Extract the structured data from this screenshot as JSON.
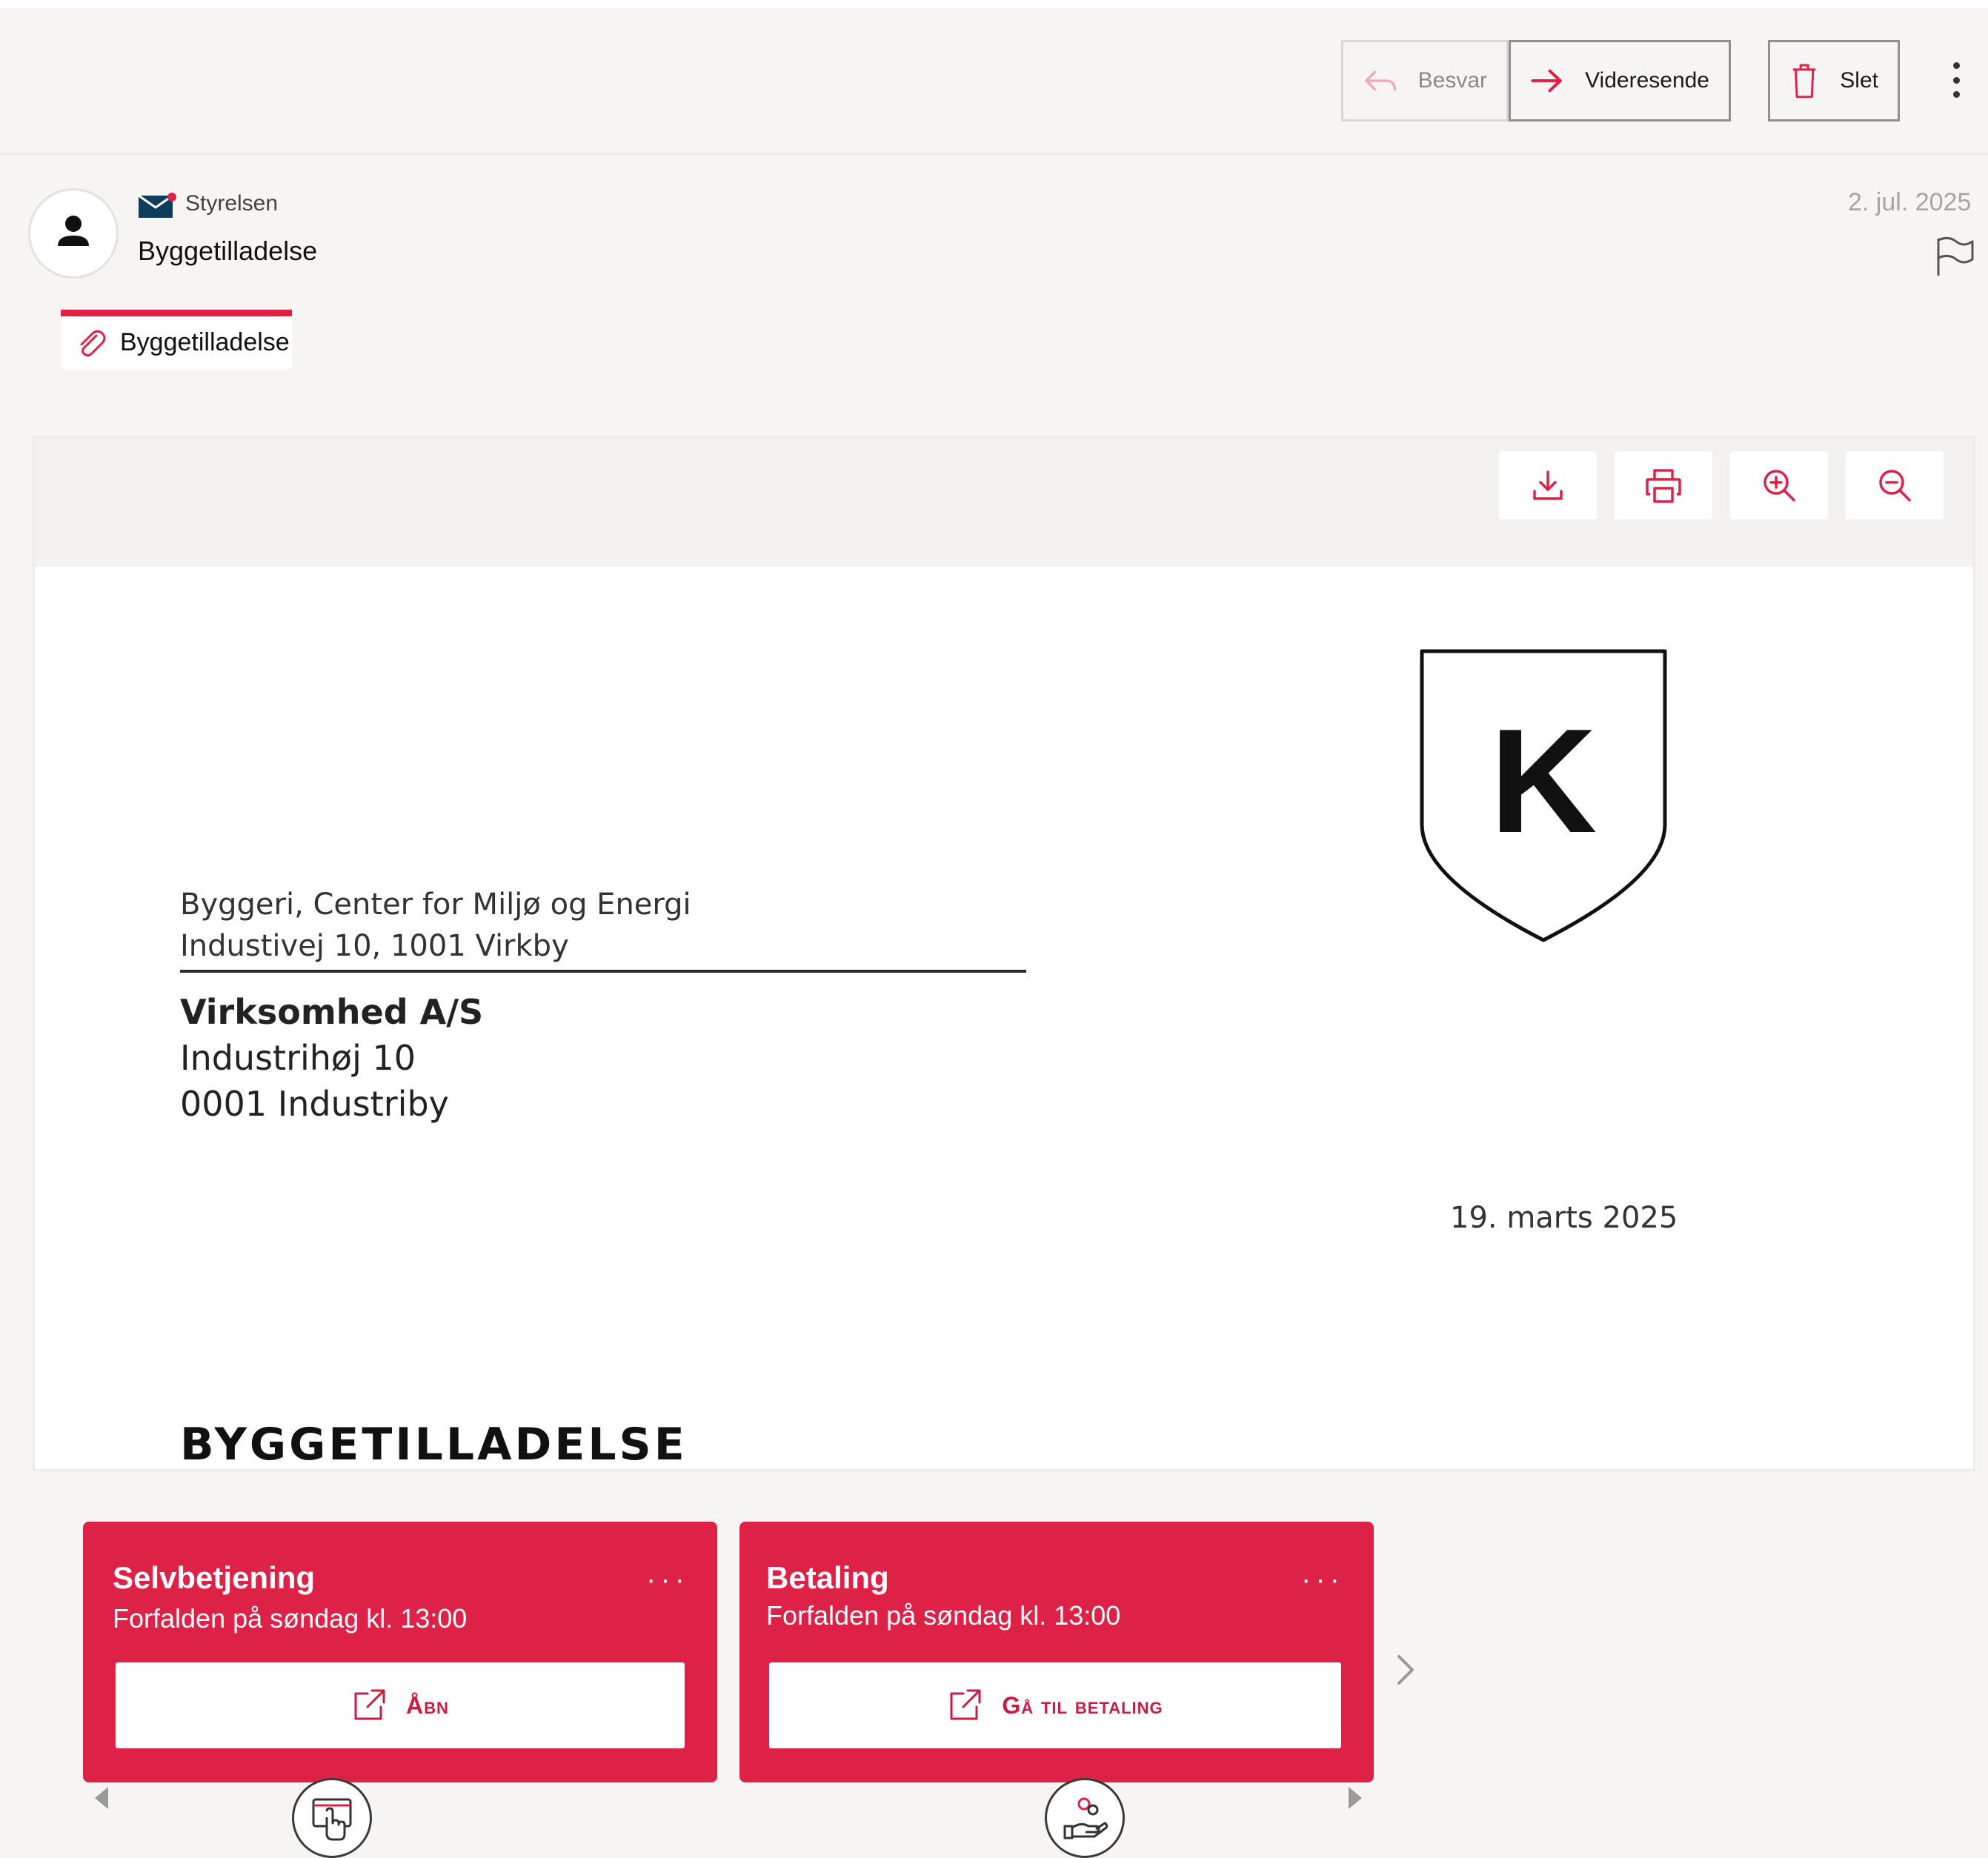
{
  "toolbar": {
    "reply_label": "Besvar",
    "forward_label": "Videresende",
    "delete_label": "Slet"
  },
  "message": {
    "sender": "Styrelsen",
    "subject": "Byggetilladelse",
    "date": "2. jul. 2025"
  },
  "attachment": {
    "name": "Byggetilladelse"
  },
  "document": {
    "sender_lines": [
      "Byggeri, Center for Miljø og Energi",
      "Industivej 10, 1001 Virkby"
    ],
    "recipient_name": "Virksomhed A/S",
    "recipient_lines": [
      "Industrihøj 10",
      "0001 Industriby"
    ],
    "crest_letter": "K",
    "date": "19. marts 2025",
    "heading": "BYGGETILLADELSE"
  },
  "cards": [
    {
      "title": "Selvbetjening",
      "due": "Forfalden på søndag kl. 13:00",
      "button": "Åbn",
      "more": "···"
    },
    {
      "title": "Betaling",
      "due": "Forfalden på søndag kl. 13:00",
      "button": "Gå til betaling",
      "more": "···"
    }
  ],
  "colors": {
    "accent": "#dd2147",
    "background": "#f6f5f4",
    "muted": "#a5a5a5"
  }
}
